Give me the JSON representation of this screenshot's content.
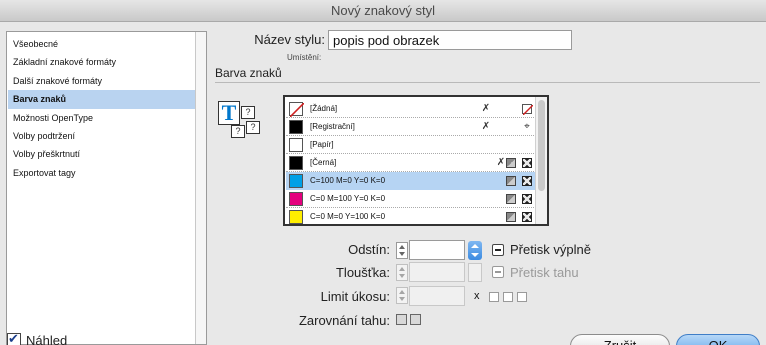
{
  "window": {
    "title": "Nový znakový styl"
  },
  "sidebar": {
    "items": [
      {
        "label": "Všeobecné"
      },
      {
        "label": "Základní znakové formáty"
      },
      {
        "label": "Další znakové formáty"
      },
      {
        "label": "Barva znaků",
        "selected": true
      },
      {
        "label": "Možnosti OpenType"
      },
      {
        "label": "Volby podtržení"
      },
      {
        "label": "Volby přeškrtnutí"
      },
      {
        "label": "Exportovat tagy"
      }
    ]
  },
  "header": {
    "name_label": "Název stylu:",
    "name_value": "popis pod obrazek",
    "location_label": "Umístění:"
  },
  "section": {
    "title": "Barva znaků"
  },
  "swatches": [
    {
      "name": "[Žádná]",
      "color": "none"
    },
    {
      "name": "[Registrační]",
      "color": "#000000"
    },
    {
      "name": "[Papír]",
      "color": "#ffffff"
    },
    {
      "name": "[Černá]",
      "color": "#000000"
    },
    {
      "name": "C=100 M=0 Y=0 K=0",
      "color": "#00a0e6",
      "selected": true
    },
    {
      "name": "C=0 M=100 Y=0 K=0",
      "color": "#e4007e"
    },
    {
      "name": "C=0 M=0 Y=100 K=0",
      "color": "#ffee00"
    }
  ],
  "controls": {
    "tint_label": "Odstín:",
    "overprint_fill_label": "Přetisk výplně",
    "weight_label": "Tloušťka:",
    "overprint_stroke_label": "Přetisk tahu",
    "miter_label": "Limit úkosu:",
    "miter_x": "x",
    "align_label": "Zarovnání tahu:"
  },
  "footer": {
    "preview_label": "Náhled",
    "cancel_label": "Zrušit",
    "ok_label": "OK"
  },
  "colors": {
    "selection": "#b9d3f0",
    "accent": "#3c8be1"
  }
}
